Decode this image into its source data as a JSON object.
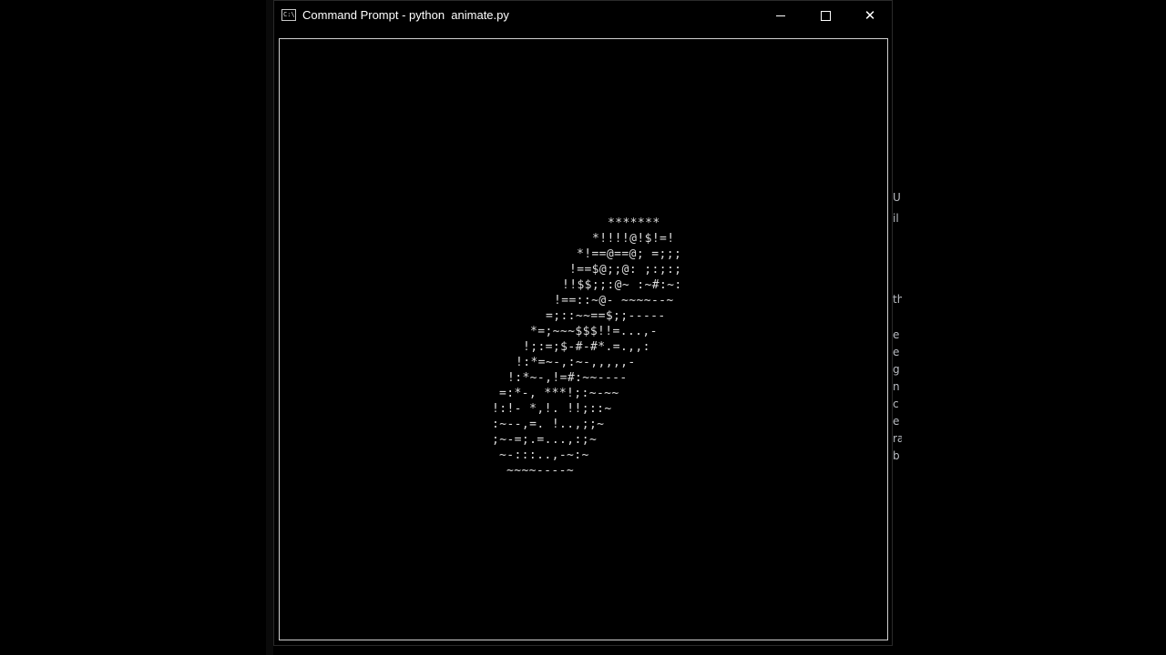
{
  "window": {
    "title": "Command Prompt - python  animate.py",
    "icon": "cmd-console-icon",
    "icon_glyph": "C:\\",
    "controls": {
      "minimize": "minimize-icon",
      "maximize": "maximize-icon",
      "close": "close-icon",
      "close_glyph": "✕"
    }
  },
  "console": {
    "background": "#000000",
    "text_color": "#dcdcdc",
    "lines": [
      "*******",
      "*!!!!@!$!=!",
      "*!==@==@; =;;;",
      "!==$@;;@: ;:;:;",
      "!!$$;;:@~ :~#:~:",
      "!==::~@- ~~~~--~",
      "=;::~~==$;;-----",
      "*=;~~~$$$!!=...,-",
      "!;:=;$-#-#*.=.,,:",
      "!:*=~-,:~-,,,,,-",
      "!:*~-,!=#:~~----",
      "=:*-, ***!;:~-~~",
      "!:!- *,!. !!;::~",
      ":~--,=. !..,;;~",
      ";~-=;.=...,:;~",
      "~-:::..,-~:~",
      "~~~~----~"
    ]
  },
  "background_window": {
    "fragments": [
      "U",
      "il",
      "th",
      "e",
      "e",
      "g",
      "n",
      "c",
      "e",
      "ra",
      "b"
    ]
  }
}
